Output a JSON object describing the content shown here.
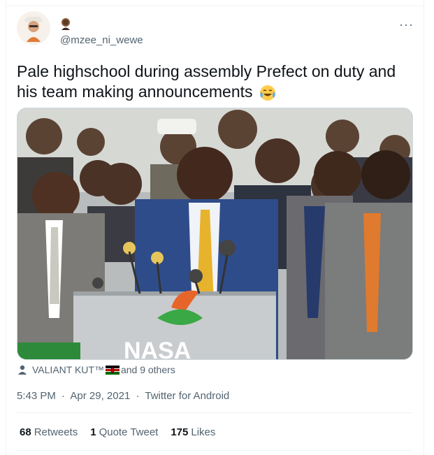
{
  "tweet": {
    "handle": "@mzee_ni_wewe",
    "text": "Pale highschool during assembly Prefect on duty and his team making announcements",
    "emoji": "face-with-tears-of-joy",
    "tagged_user": "VALIANT KUT™",
    "tagged_flag": "kenya-flag",
    "tagged_others": " and 9 others",
    "time": "5:43 PM",
    "date": "Apr 29, 2021",
    "source": "Twitter for Android",
    "separator": "·",
    "more_icon": "···"
  },
  "stats": {
    "retweets_count": "68",
    "retweets_label": "Retweets",
    "quote_count": "1",
    "quote_label": "Quote Tweet",
    "likes_count": "175",
    "likes_label": "Likes"
  },
  "media": {
    "logo_text": "NASA"
  },
  "colors": {
    "text_primary": "#0f1419",
    "text_secondary": "#536471",
    "border": "#eff3f4",
    "nasa_orange": "#e8652a",
    "nasa_green": "#3aa845"
  }
}
